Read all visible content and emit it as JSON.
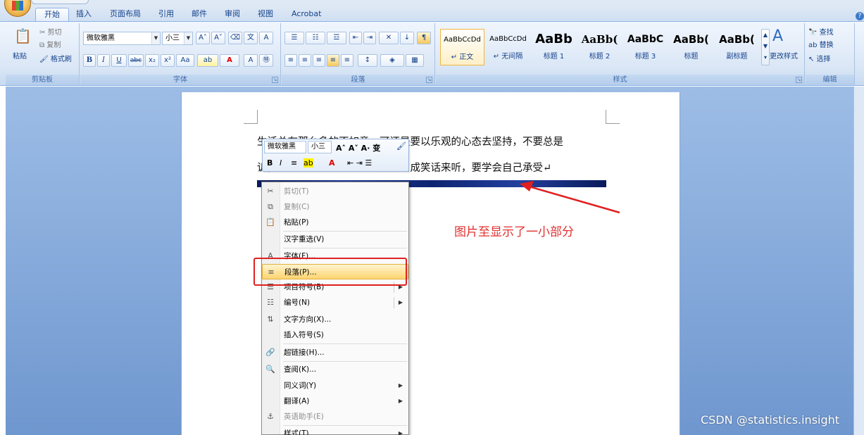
{
  "tabs": [
    "开始",
    "插入",
    "页面布局",
    "引用",
    "邮件",
    "审阅",
    "视图",
    "Acrobat"
  ],
  "clipboard": {
    "paste": "粘贴",
    "cut": "剪切",
    "copy": "复制",
    "format_painter": "格式刷",
    "label": "剪贴板"
  },
  "font_group": {
    "font_name": "微软雅黑",
    "font_size": "小三",
    "label": "字体",
    "bold": "B",
    "italic": "I",
    "underline": "U",
    "strike": "abc",
    "sub": "x₂",
    "sup": "x²",
    "aa": "Aa",
    "color_a": "A"
  },
  "paragraph_group": {
    "label": "段落"
  },
  "styles": [
    {
      "sample": "AaBbCcDd",
      "name": "↵ 正文"
    },
    {
      "sample": "AaBbCcDd",
      "name": "↵ 无间隔"
    },
    {
      "sample": "AaBb",
      "name": "标题 1"
    },
    {
      "sample": "AaBb(",
      "name": "标题 2"
    },
    {
      "sample": "AaBbC",
      "name": "标题 3"
    },
    {
      "sample": "AaBb(",
      "name": "标题"
    },
    {
      "sample": "AaBb(",
      "name": "副标题"
    }
  ],
  "styles_label": "样式",
  "change_styles": "更改样式",
  "edit_group": {
    "find": "查找",
    "replace": "替换",
    "select": "选择",
    "label": "编辑"
  },
  "document": {
    "line1": "生活总有那么多的不如意，可还是要以乐观的心态去坚持，不要总是",
    "line2": "诉，………………………的只会当成笑话来听，要学会自己承受↵"
  },
  "minitoolbar": {
    "font": "微软雅黑",
    "size": "小三"
  },
  "context_menu": [
    {
      "label": "剪切(T)",
      "icon": "✂",
      "disabled": true
    },
    {
      "label": "复制(C)",
      "icon": "⧉",
      "disabled": true
    },
    {
      "label": "粘贴(P)",
      "icon": "📋",
      "disabled": false
    },
    {
      "label": "汉字重选(V)",
      "icon": "",
      "disabled": false
    },
    {
      "label": "字体(F)...",
      "icon": "A",
      "disabled": false
    },
    {
      "label": "段落(P)...",
      "icon": "≡",
      "disabled": false,
      "highlight": true
    },
    {
      "label": "项目符号(B)",
      "icon": "☰",
      "disabled": false,
      "submenu": true
    },
    {
      "label": "编号(N)",
      "icon": "☷",
      "disabled": false,
      "submenu": true
    },
    {
      "label": "文字方向(X)...",
      "icon": "⇅",
      "disabled": false
    },
    {
      "label": "插入符号(S)",
      "icon": "",
      "disabled": false
    },
    {
      "label": "超链接(H)...",
      "icon": "🔗",
      "disabled": false
    },
    {
      "label": "查阅(K)...",
      "icon": "🔍",
      "disabled": false
    },
    {
      "label": "同义词(Y)",
      "icon": "",
      "disabled": false,
      "submenu": true
    },
    {
      "label": "翻译(A)",
      "icon": "",
      "disabled": false,
      "submenu": true
    },
    {
      "label": "英语助手(E)",
      "icon": "⚓",
      "disabled": true
    },
    {
      "label": "样式(T)",
      "icon": "",
      "disabled": false,
      "submenu": true
    }
  ],
  "annotation": "图片至显示了一小部分",
  "watermark": "CSDN @statistics.insight"
}
